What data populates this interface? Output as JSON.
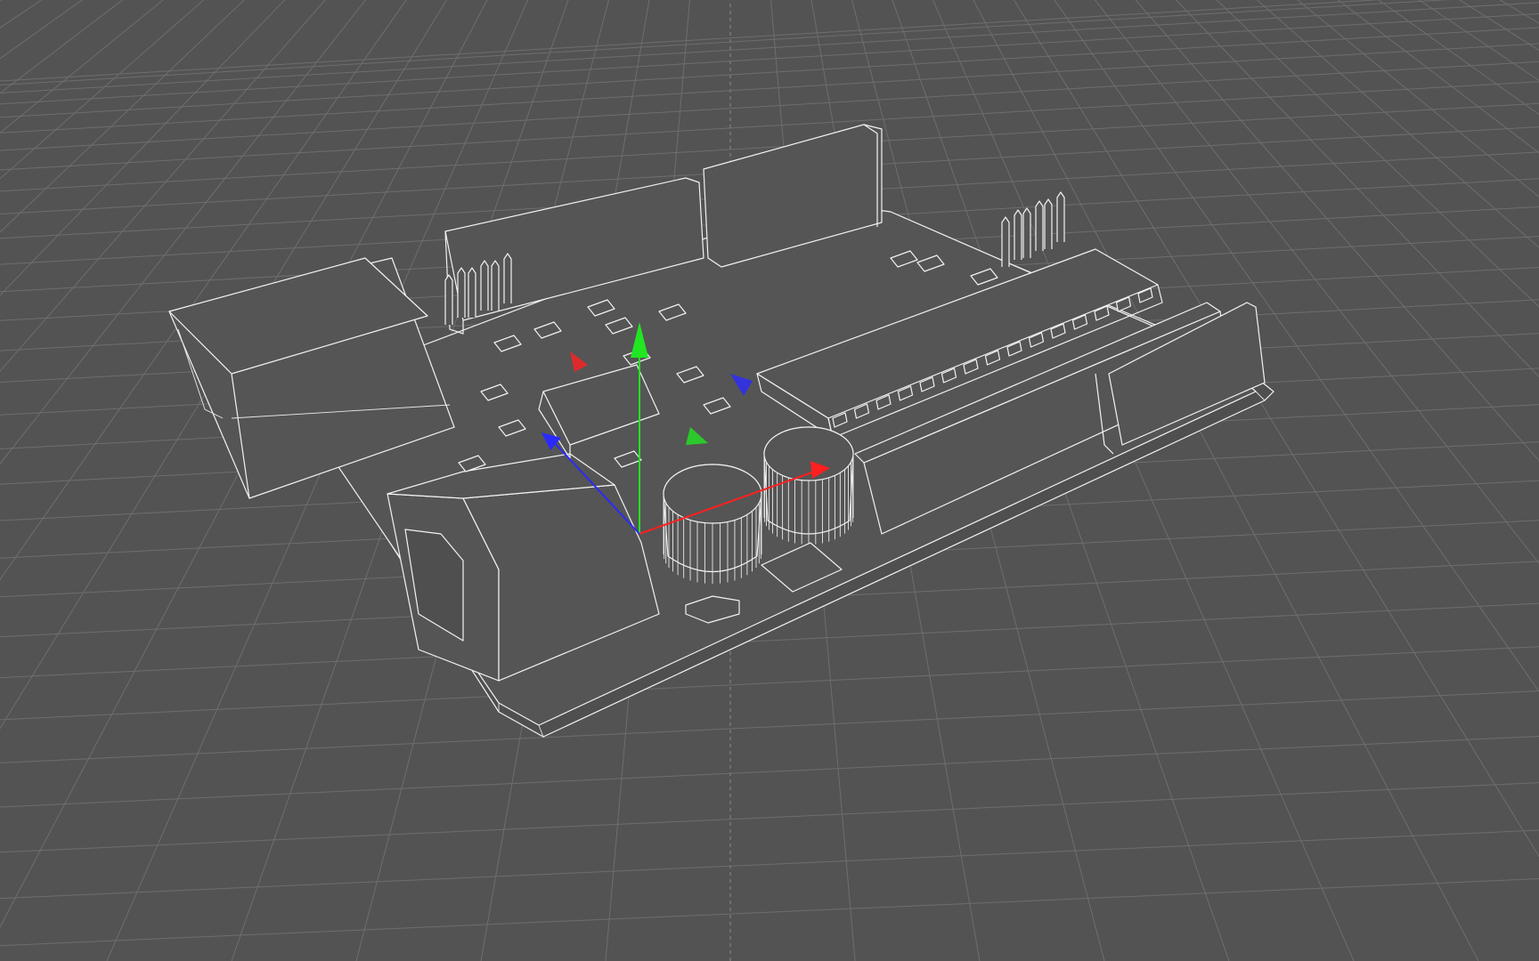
{
  "viewport": {
    "background_color": "#535353",
    "grid_color": "#6e6e6e",
    "wire_color": "#f2f2f2",
    "render_mode": "wireframe"
  },
  "gizmo": {
    "x_axis_color": "#ff2020",
    "y_axis_color": "#22e622",
    "z_axis_color": "#2a2aff"
  },
  "model": {
    "icon": "circuit-board-model"
  }
}
